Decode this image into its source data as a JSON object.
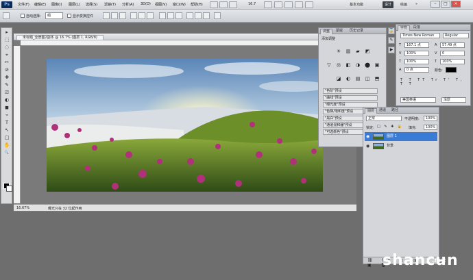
{
  "app": {
    "logo": "Ps",
    "zoom": "16.7"
  },
  "menu": [
    "文件(F)",
    "编辑(E)",
    "图像(I)",
    "图层(L)",
    "选择(S)",
    "滤镜(T)",
    "分析(A)",
    "3D(D)",
    "视图(V)",
    "窗口(W)",
    "帮助(H)"
  ],
  "workspace": {
    "basic": "基本功能",
    "design": "设计",
    "painting": "绘画"
  },
  "window_controls": {
    "min": "–",
    "max": "□",
    "close": "×"
  },
  "options": {
    "auto_select_label": "自动选择:",
    "auto_select_value": "组",
    "show_transform_label": "显示变换控件"
  },
  "tools": [
    "▸",
    "⬚",
    "◌",
    "⌖",
    "✂",
    "⊘",
    "✚",
    "✎",
    "⎚",
    "◐",
    "◼",
    "⌁",
    "T",
    "↖",
    "□",
    "✋",
    "🔍"
  ],
  "document": {
    "tab_title": "未标题_全景图2副本 @ 16.7% (图层 1, RGB/8)",
    "status_zoom": "16.67%",
    "status_info": "曝光只在 32 位起作用"
  },
  "adjustments": {
    "tabs": [
      "调整",
      "蒙版",
      "历史记录"
    ],
    "title": "添加调整",
    "icons": [
      "☀",
      "▥",
      "▰",
      "◩",
      "▽",
      "⚖",
      "◧",
      "◑",
      "⬤",
      "▣",
      "◪",
      "◐",
      "▤",
      "◫",
      "⬒"
    ],
    "presets": [
      "\"色阶\"预设",
      "\"曲线\"预设",
      "\"曝光度\"预设",
      "\"色相/饱和度\"预设",
      "\"黑白\"预设",
      "\"通道混和器\"预设",
      "\"可选颜色\"预设"
    ]
  },
  "character": {
    "tabs": [
      "字符",
      "段落"
    ],
    "font": "Times New Roman",
    "style": "Regular",
    "size": "167.1 点",
    "leading": "57.49 点",
    "tracking": "0",
    "kerning": "100%",
    "vscale": "100%",
    "hscale": "100%",
    "baseline": "0 点",
    "color_label": "颜色:",
    "language": "美国英语",
    "aa": "浑厚"
  },
  "layers": {
    "tabs": [
      "图层",
      "通道",
      "路径"
    ],
    "blend": "正常",
    "opacity_label": "不透明度:",
    "opacity": "100%",
    "lock_label": "锁定:",
    "fill_label": "填充:",
    "fill": "100%",
    "items": [
      {
        "name": "图层 1",
        "selected": true
      },
      {
        "name": "背景",
        "selected": false
      }
    ]
  },
  "watermark": {
    "text": "shancun",
    "suffix": ".net"
  },
  "colors": {
    "accent": "#3a7bd5",
    "menubar": "#d2d4d8",
    "workspace": "#6e6e6e"
  }
}
